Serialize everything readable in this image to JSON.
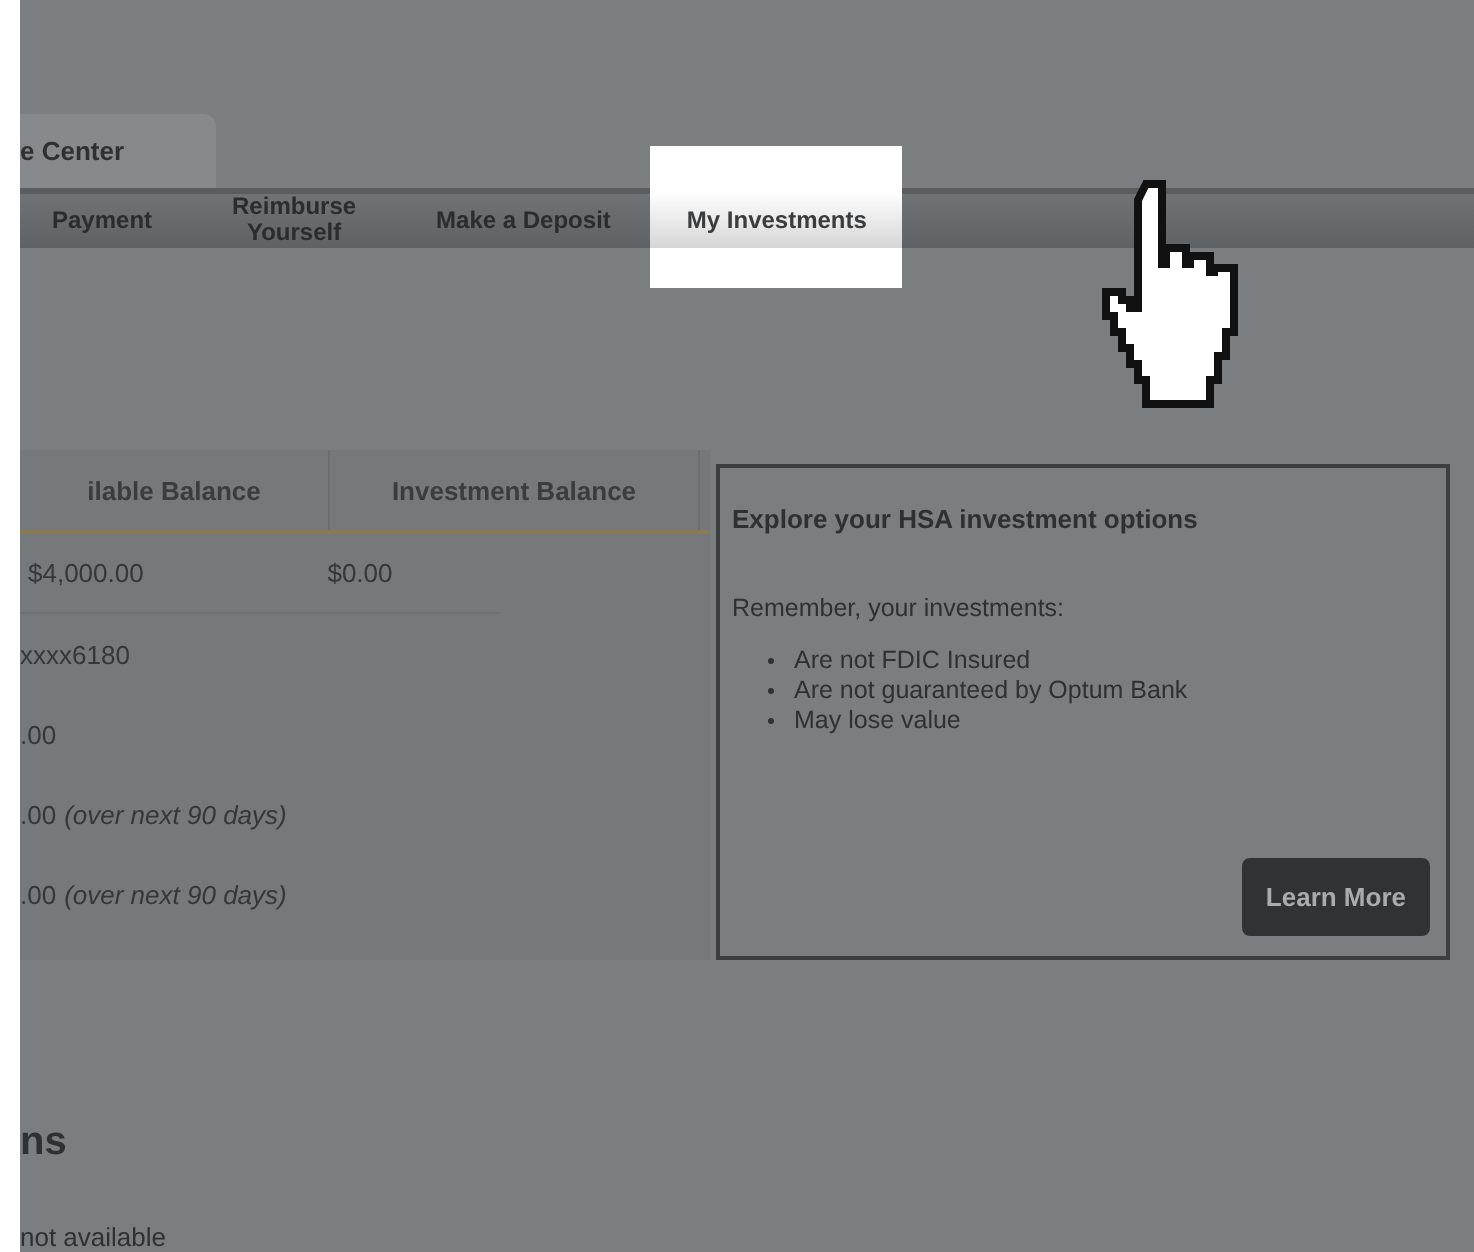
{
  "top_tab": {
    "label": "e Center"
  },
  "nav": [
    {
      "label": "Payment",
      "selected": false
    },
    {
      "label": "Reimburse Yourself",
      "selected": false
    },
    {
      "label": "Make a Deposit",
      "selected": false
    },
    {
      "label": "My Investments",
      "selected": true
    }
  ],
  "balance_table": {
    "columns": [
      "ilable Balance",
      "Investment Balance"
    ],
    "rows": [
      [
        "$4,000.00",
        "$0.00"
      ]
    ]
  },
  "account_lines": [
    {
      "value": "xxxx6180"
    },
    {
      "value": ".00"
    },
    {
      "value": ".00",
      "note": "(over next 90 days)"
    },
    {
      "value": ".00",
      "note": "(over next 90 days)"
    }
  ],
  "info_box": {
    "title": "Explore your HSA investment options",
    "intro": "Remember, your investments:",
    "bullets": [
      "Are not FDIC Insured",
      "Are not guaranteed by Optum Bank",
      "May lose value"
    ],
    "button": "Learn More"
  },
  "section": {
    "heading": "ns",
    "text": "not available"
  }
}
